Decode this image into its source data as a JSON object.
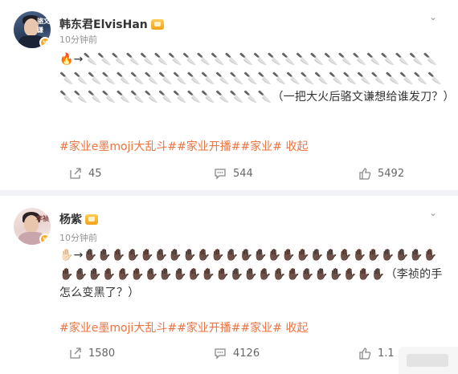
{
  "posts": [
    {
      "author": "韩东君ElvisHan",
      "time": "10分钟前",
      "content": "🔥→🔪🔪🔪🔪🔪🔪🔪🔪🔪🔪🔪🔪🔪🔪🔪🔪🔪🔪🔪🔪🔪🔪🔪🔪🔪🔪🔪🔪🔪🔪🔪🔪🔪🔪🔪🔪🔪🔪🔪🔪🔪🔪🔪🔪🔪🔪🔪🔪🔪🔪🔪🔪🔪🔪🔪🔪🔪🔪🔪🔪🔪🔪🔪🔪🔪🔪🔪（一把大火后骆文谦想给谁发刀？）",
      "tags": [
        "#家业e墨moji大乱斗#",
        "#家业开播#",
        "#家业#"
      ],
      "collapse": "收起",
      "share_count": "45",
      "comment_count": "544",
      "like_count": "5492",
      "avatar_text": "骆文谦"
    },
    {
      "author": "杨紫",
      "time": "10分钟前",
      "content": "✋🏻→✋🏿✋🏿✋🏿✋🏿✋🏿✋🏿✋🏿✋🏿✋🏿✋🏿✋🏿✋🏿✋🏿✋🏿✋🏿✋🏿✋🏿✋🏿✋🏿✋🏿✋🏿✋🏿✋🏿✋🏿✋🏿✋🏿✋🏿✋🏿✋🏿✋🏿✋🏿✋🏿✋🏿✋🏿✋🏿✋🏿✋🏿✋🏿✋🏿✋🏿✋🏿✋🏿✋🏿✋🏿✋🏿✋🏿✋🏿✋🏿（李祯的手怎么变黑了？）",
      "tags": [
        "#家业e墨moji大乱斗#",
        "#家业开播#",
        "#家业#"
      ],
      "collapse": "收起",
      "share_count": "1580",
      "comment_count": "4126",
      "like_count": "1.1",
      "avatar_text": "李祯"
    }
  ],
  "colors": {
    "accent": "#eb7340",
    "badge": "#ffa617"
  }
}
